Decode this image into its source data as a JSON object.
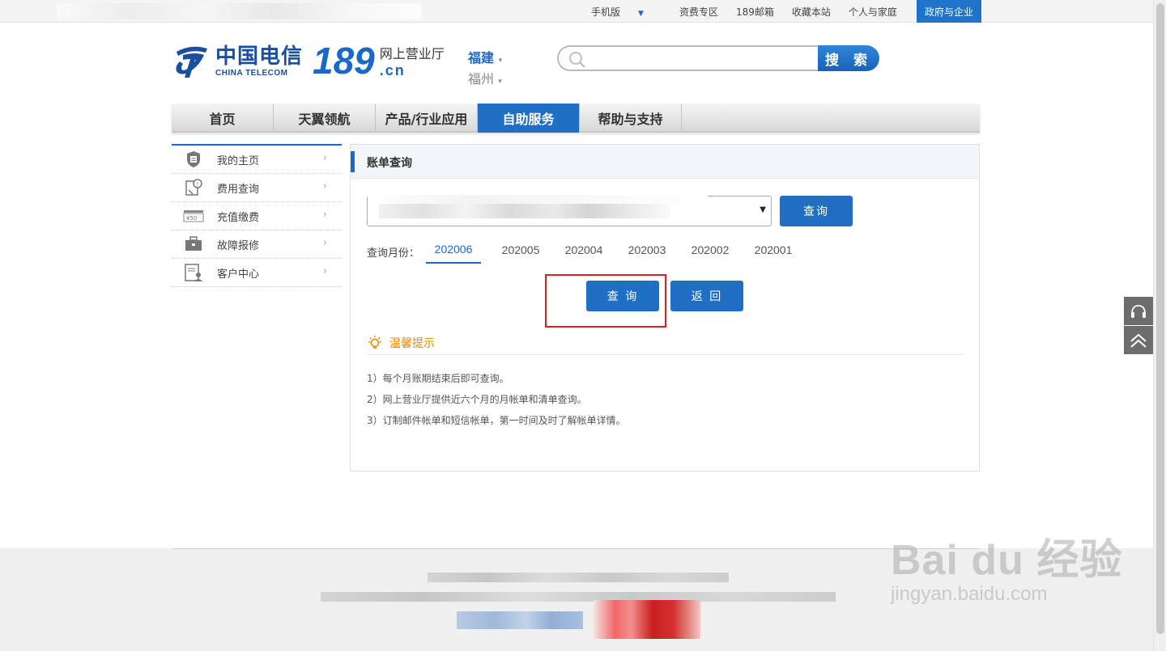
{
  "topbar": {
    "links": [
      "手机版",
      "资费专区",
      "189邮箱",
      "收藏本站",
      "个人与家庭"
    ],
    "gov_button": "政府与企业"
  },
  "header": {
    "logo_cn": "中国电信",
    "logo_en": "CHINA TELECOM",
    "logo_num": "189",
    "hall": "网上营业厅",
    "domain": ".cn",
    "province": "福建",
    "city": "福州",
    "search_button": "搜 索",
    "search_placeholder": ""
  },
  "nav": {
    "items": [
      "首页",
      "天翼领航",
      "产品/行业应用",
      "自助服务",
      "帮助与支持"
    ],
    "active": "自助服务"
  },
  "sidebar": {
    "items": [
      "我的主页",
      "费用查询",
      "充值缴费",
      "故障报修",
      "客户中心"
    ]
  },
  "panel": {
    "title": "账单查询",
    "query_button": "查询",
    "month_label": "查询月份：",
    "months": [
      "202006",
      "202005",
      "202004",
      "202003",
      "202002",
      "202001"
    ],
    "selected_month": "202006",
    "submit_button": "查 询",
    "back_button": "返 回",
    "tips_title": "温馨提示",
    "tips": [
      "1）每个月账期结束后即可查询。",
      "2）网上营业厅提供近六个月的月帐单和清单查询。",
      "3）订制邮件帐单和短信帐单，第一时间及时了解帐单详情。"
    ]
  },
  "watermark": {
    "brand": "Bai du 经验",
    "url": "jingyan.baidu.com"
  },
  "colors": {
    "brand_blue": "#1f6fc5",
    "tip_orange": "#f08a00",
    "highlight_red": "#e02020"
  }
}
